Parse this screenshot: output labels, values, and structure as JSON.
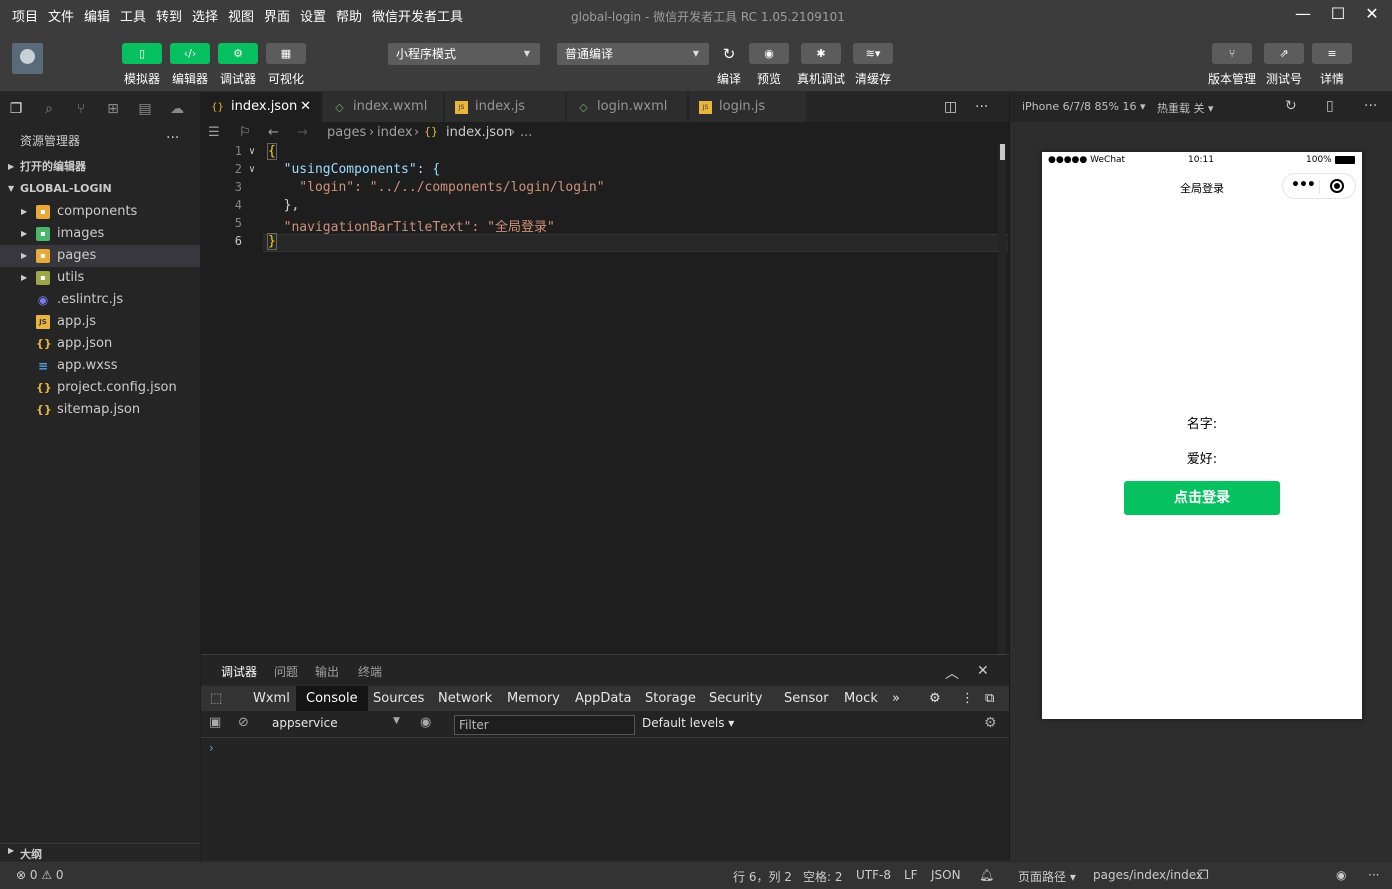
{
  "menubar": {
    "items": [
      "项目",
      "文件",
      "编辑",
      "工具",
      "转到",
      "选择",
      "视图",
      "界面",
      "设置",
      "帮助",
      "微信开发者工具"
    ],
    "window_title": "global-login - 微信开发者工具 RC 1.05.2109101",
    "controls": [
      "minimize-icon",
      "maximize-icon",
      "close-icon"
    ]
  },
  "toolbar": {
    "simulator": "模拟器",
    "editor": "编辑器",
    "debugger": "调试器",
    "visual": "可视化",
    "mode_select": "小程序模式",
    "compile_select": "普通编译",
    "compile": "编译",
    "preview": "预览",
    "remote_debug": "真机调试",
    "clear_cache": "清缓存",
    "version_mgmt": "版本管理",
    "test_account": "测试号",
    "details": "详情"
  },
  "explorer": {
    "title": "资源管理器",
    "open_editors": "打开的编辑器",
    "project": "GLOBAL-LOGIN",
    "items": [
      {
        "name": "components",
        "type": "folder"
      },
      {
        "name": "images",
        "type": "folder"
      },
      {
        "name": "pages",
        "type": "folder"
      },
      {
        "name": "utils",
        "type": "folder"
      },
      {
        "name": ".eslintrc.js",
        "type": "eslint"
      },
      {
        "name": "app.js",
        "type": "js"
      },
      {
        "name": "app.json",
        "type": "json"
      },
      {
        "name": "app.wxss",
        "type": "css"
      },
      {
        "name": "project.config.json",
        "type": "json"
      },
      {
        "name": "sitemap.json",
        "type": "json"
      }
    ],
    "outline": "大纲"
  },
  "tabs": [
    {
      "label": "index.json",
      "icon": "json",
      "active": true
    },
    {
      "label": "index.wxml",
      "icon": "wxml",
      "active": false
    },
    {
      "label": "index.js",
      "icon": "js",
      "active": false
    },
    {
      "label": "login.wxml",
      "icon": "wxml",
      "active": false
    },
    {
      "label": "login.js",
      "icon": "js",
      "active": false
    }
  ],
  "breadcrumb": {
    "parts": [
      "pages",
      "index",
      "index.json",
      "..."
    ]
  },
  "code": {
    "line_numbers": [
      "1",
      "2",
      "3",
      "4",
      "5",
      "6"
    ],
    "lines": [
      "{",
      "  \"usingComponents\": {",
      "    \"login\": \"../../components/login/login\"",
      "  },",
      "  \"navigationBarTitleText\": \"全局登录\"",
      "}"
    ]
  },
  "debugger": {
    "top_tabs": [
      "调试器",
      "问题",
      "输出",
      "终端"
    ],
    "dev_tabs": [
      "Wxml",
      "Console",
      "Sources",
      "Network",
      "Memory",
      "AppData",
      "Storage",
      "Security",
      "Sensor",
      "Mock"
    ],
    "more": "»",
    "context": "appservice",
    "filter_placeholder": "Filter",
    "levels": "Default levels ▾",
    "prompt": "›"
  },
  "simulator": {
    "device": "iPhone 6/7/8 85% 16 ▾",
    "hot_reload": "热重载 关 ▾",
    "status_left": "●●●●● WeChat",
    "status_time": "10:11",
    "status_battery": "100%",
    "nav_title": "全局登录",
    "name_label": "名字:",
    "hobby_label": "爱好:",
    "login_button": "点击登录"
  },
  "statusbar": {
    "problems": "⊗ 0 ⚠ 0",
    "position": "行 6，列 2",
    "spaces": "空格: 2",
    "encoding": "UTF-8",
    "eol": "LF",
    "language": "JSON",
    "page_path_label": "页面路径 ▾",
    "page_path": "pages/index/index"
  },
  "colors": {
    "accent": "#07c160",
    "editor_bg": "#1e1e1e",
    "sidebar_bg": "#252526"
  }
}
